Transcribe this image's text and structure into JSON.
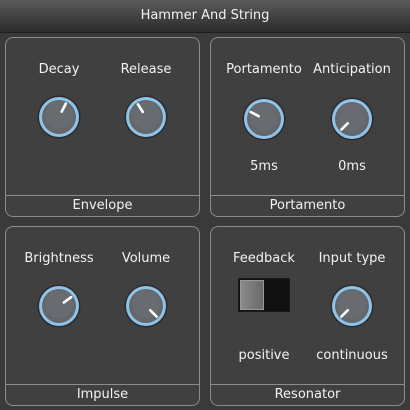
{
  "window": {
    "title": "Hammer And String"
  },
  "colors": {
    "knob_ring": "#8fc4e8",
    "knob_body": "#63666b",
    "pointer": "#ffffff"
  },
  "panels": {
    "envelope": {
      "title": "Envelope",
      "controls": [
        {
          "label": "Decay",
          "level": 0.6
        },
        {
          "label": "Release",
          "level": 0.38
        }
      ]
    },
    "portamento": {
      "title": "Portamento",
      "controls": [
        {
          "label": "Portamento",
          "value": "5ms",
          "level": 0.27
        },
        {
          "label": "Anticipation",
          "value": "0ms",
          "level": 0.0
        }
      ]
    },
    "impulse": {
      "title": "Impulse",
      "controls": [
        {
          "label": "Brightness",
          "level": 0.7
        },
        {
          "label": "Volume",
          "level": 1.0
        }
      ]
    },
    "resonator": {
      "title": "Resonator",
      "controls": [
        {
          "label": "Feedback",
          "value": "positive",
          "toggle_on": false
        },
        {
          "label": "Input type",
          "value": "continuous",
          "level": 0.0
        }
      ]
    }
  }
}
